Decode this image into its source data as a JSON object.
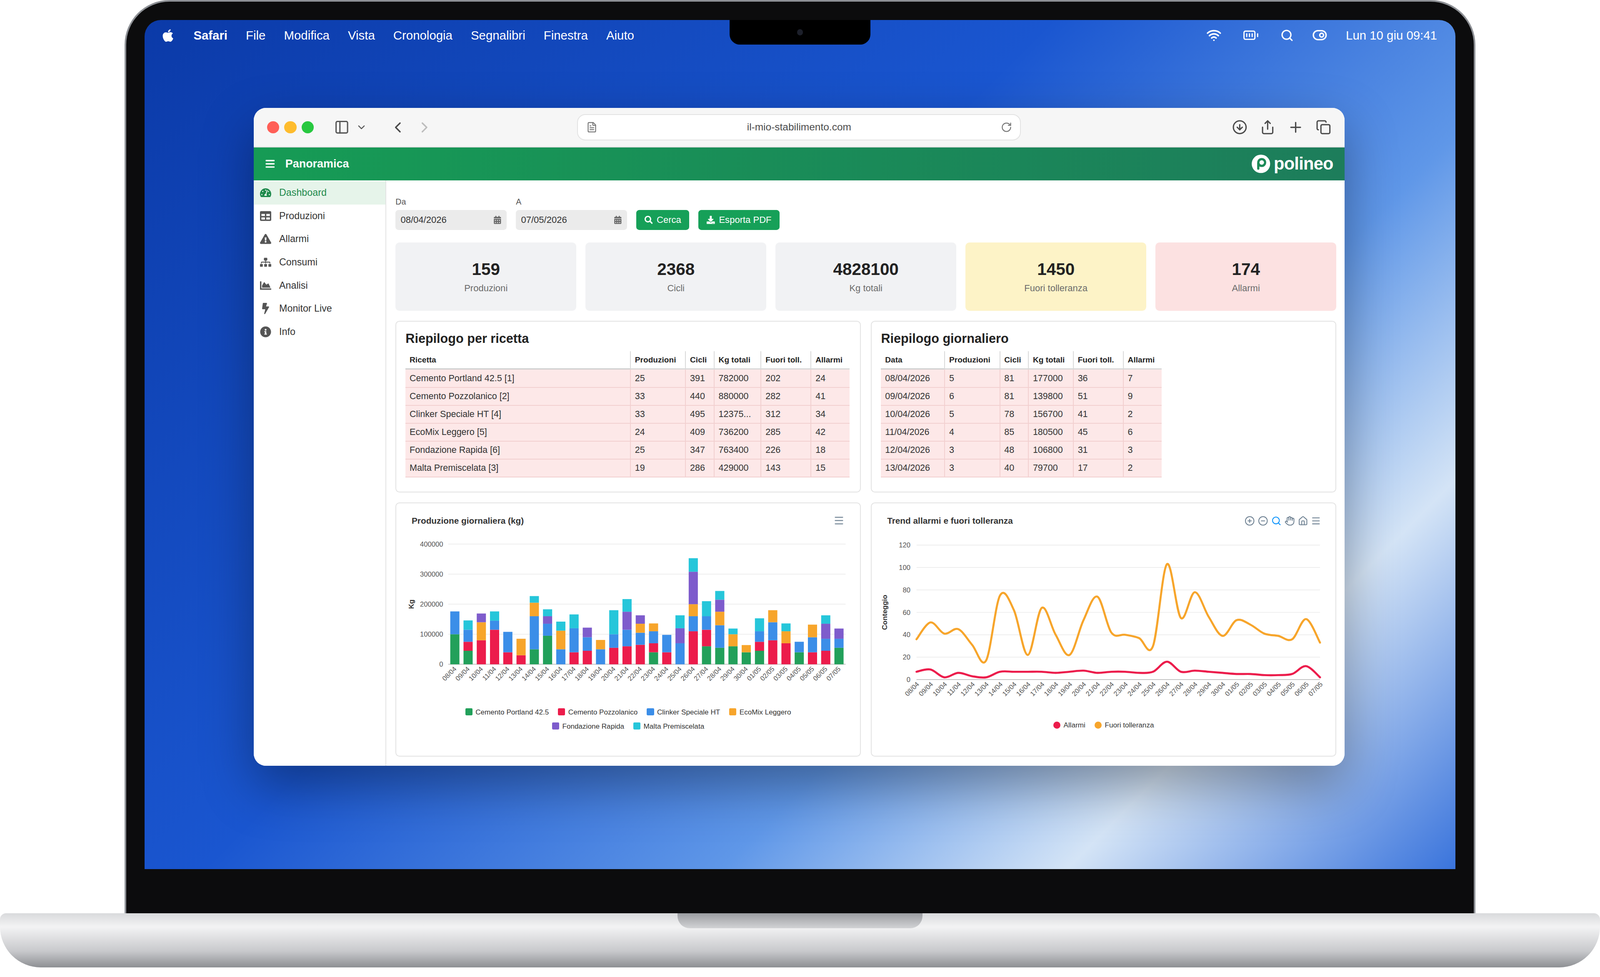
{
  "menu_bar": {
    "app": "Safari",
    "items": [
      "File",
      "Modifica",
      "Vista",
      "Cronologia",
      "Segnalibri",
      "Finestra",
      "Aiuto"
    ],
    "clock": "Lun 10 giu 09:41"
  },
  "browser": {
    "url": "il-mio-stabilimento.com",
    "back_enabled": true,
    "forward_enabled": false
  },
  "app_header": {
    "title": "Panoramica",
    "logo": "polineo"
  },
  "sidebar": {
    "items": [
      {
        "label": "Dashboard",
        "selected": true
      },
      {
        "label": "Produzioni",
        "selected": false
      },
      {
        "label": "Allarmi",
        "selected": false
      },
      {
        "label": "Consumi",
        "selected": false
      },
      {
        "label": "Analisi",
        "selected": false
      },
      {
        "label": "Monitor Live",
        "selected": false
      },
      {
        "label": "Info",
        "selected": false
      }
    ]
  },
  "filters": {
    "from": {
      "label": "Da",
      "value": "08/04/2026"
    },
    "to": {
      "label": "A",
      "value": "07/05/2026"
    },
    "buttons": [
      "Cerca",
      "Esporta PDF"
    ]
  },
  "kpis": [
    {
      "value": "159",
      "label": "Produzioni",
      "color": "#f1f2f4"
    },
    {
      "value": "2368",
      "label": "Cicli",
      "color": "#f1f2f4"
    },
    {
      "value": "4828100",
      "label": "Kg totali",
      "color": "#f1f2f4"
    },
    {
      "value": "1450",
      "label": "Fuori tolleranza",
      "color": "#fdf3c7"
    },
    {
      "value": "174",
      "label": "Allarmi",
      "color": "#fce1e1"
    }
  ],
  "recipe_table": {
    "title": "Riepilogo per ricetta",
    "columns": [
      "Ricetta",
      "Produzioni",
      "Cicli",
      "Kg totali",
      "Fuori toll.",
      "Allarmi"
    ],
    "rows": [
      [
        "Cemento Portland 42.5 [1]",
        "25",
        "391",
        "782000",
        "202",
        "24"
      ],
      [
        "Cemento Pozzolanico [2]",
        "33",
        "440",
        "880000",
        "282",
        "41"
      ],
      [
        "Clinker Speciale HT [4]",
        "33",
        "495",
        "12375...",
        "312",
        "34"
      ],
      [
        "EcoMix Leggero [5]",
        "24",
        "409",
        "736200",
        "285",
        "42"
      ],
      [
        "Fondazione Rapida [6]",
        "25",
        "347",
        "763400",
        "226",
        "18"
      ],
      [
        "Malta Premiscelata [3]",
        "19",
        "286",
        "429000",
        "143",
        "15"
      ]
    ]
  },
  "daily_table": {
    "title": "Riepilogo giornaliero",
    "columns": [
      "Data",
      "Produzioni",
      "Cicli",
      "Kg totali",
      "Fuori toll.",
      "Allarmi"
    ],
    "rows": [
      [
        "08/04/2026",
        "5",
        "81",
        "177000",
        "36",
        "7"
      ],
      [
        "09/04/2026",
        "6",
        "81",
        "139800",
        "51",
        "9"
      ],
      [
        "10/04/2026",
        "5",
        "78",
        "156700",
        "41",
        "2"
      ],
      [
        "11/04/2026",
        "4",
        "85",
        "180500",
        "45",
        "6"
      ],
      [
        "12/04/2026",
        "3",
        "48",
        "106800",
        "31",
        "3"
      ],
      [
        "13/04/2026",
        "3",
        "40",
        "79700",
        "17",
        "2"
      ]
    ]
  },
  "production_chart": {
    "title": "Produzione giornaliera (kg)",
    "y_axis_label": "Kg",
    "y_ticks": [
      "400000",
      "300000",
      "200000",
      "100000",
      "0"
    ],
    "x_labels": [
      "08/04",
      "09/04",
      "10/04",
      "11/04",
      "12/04",
      "13/04",
      "14/04",
      "15/04",
      "16/04",
      "17/04",
      "18/04",
      "19/04",
      "20/04",
      "21/04",
      "22/04",
      "23/04",
      "24/04",
      "25/04",
      "26/04",
      "27/04",
      "28/04",
      "29/04",
      "30/04",
      "01/05",
      "02/05",
      "03/05",
      "04/05",
      "05/05",
      "06/05",
      "07/05"
    ],
    "series": [
      {
        "name": "Cemento Portland 42.5",
        "color": "#22a05a",
        "values": [
          100000,
          45000,
          0,
          0,
          0,
          0,
          50000,
          95000,
          0,
          0,
          0,
          0,
          0,
          0,
          0,
          40000,
          0,
          0,
          0,
          60000,
          55000,
          60000,
          40000,
          45000,
          0,
          0,
          40000,
          0,
          0,
          55000
        ]
      },
      {
        "name": "Cemento Pozzolanico",
        "color": "#ec1c4b",
        "values": [
          0,
          30000,
          80000,
          115000,
          40000,
          30000,
          0,
          0,
          0,
          40000,
          45000,
          0,
          55000,
          60000,
          65000,
          30000,
          40000,
          0,
          110000,
          55000,
          0,
          0,
          0,
          30000,
          80000,
          70000,
          0,
          40000,
          45000,
          0
        ]
      },
      {
        "name": "Clinker Speciale HT",
        "color": "#3b8ee8",
        "values": [
          76000,
          40000,
          0,
          30000,
          68000,
          0,
          110000,
          40000,
          50000,
          80000,
          45000,
          50000,
          45000,
          55000,
          40000,
          40000,
          58000,
          70000,
          50000,
          45000,
          75000,
          0,
          0,
          35000,
          60000,
          0,
          35000,
          50000,
          40000,
          30000
        ]
      },
      {
        "name": "EcoMix Leggero",
        "color": "#f7a52b",
        "values": [
          0,
          0,
          60000,
          0,
          0,
          55000,
          45000,
          0,
          62000,
          0,
          0,
          31000,
          0,
          0,
          30000,
          26000,
          0,
          0,
          40000,
          0,
          45000,
          40000,
          24000,
          0,
          40000,
          40000,
          0,
          42000,
          0,
          0
        ]
      },
      {
        "name": "Fondazione Rapida",
        "color": "#7e5ccc",
        "values": [
          0,
          0,
          29000,
          0,
          0,
          0,
          0,
          25000,
          0,
          0,
          32000,
          0,
          0,
          60000,
          28000,
          0,
          0,
          50000,
          108000,
          0,
          40000,
          0,
          0,
          0,
          0,
          0,
          0,
          0,
          50000,
          34000
        ]
      },
      {
        "name": "Malta Premiscelata",
        "color": "#26c6da",
        "values": [
          0,
          31000,
          0,
          31000,
          0,
          0,
          22000,
          23000,
          30000,
          46000,
          0,
          0,
          80000,
          42000,
          0,
          0,
          0,
          43000,
          45000,
          50000,
          29000,
          19000,
          0,
          43000,
          0,
          26000,
          0,
          0,
          28000,
          0
        ]
      }
    ]
  },
  "trend_chart": {
    "title": "Trend allarmi e fuori tolleranza",
    "toolbar": [
      {
        "selected": false
      },
      {
        "selected": false
      },
      {
        "selected": true
      },
      {
        "selected": false
      },
      {
        "selected": false
      },
      {
        "selected": false
      }
    ],
    "y_axis_label": "Conteggio",
    "y_ticks": [
      "120",
      "100",
      "80",
      "60",
      "40",
      "20",
      "0"
    ],
    "x_labels": [
      "08/04",
      "09/04",
      "10/04",
      "11/04",
      "12/04",
      "13/04",
      "14/04",
      "15/04",
      "16/04",
      "17/04",
      "18/04",
      "19/04",
      "20/04",
      "21/04",
      "22/04",
      "23/04",
      "24/04",
      "25/04",
      "26/04",
      "27/04",
      "28/04",
      "29/04",
      "30/04",
      "01/05",
      "02/05",
      "03/05",
      "04/05",
      "05/05",
      "06/05",
      "07/05"
    ],
    "series": [
      {
        "name": "Allarmi",
        "color": "#ec1c4b",
        "values": [
          7,
          9,
          2,
          6,
          3,
          2,
          7,
          7,
          7,
          7,
          6,
          7,
          8,
          6,
          7,
          7,
          6,
          7,
          16,
          7,
          8,
          7,
          6,
          5,
          5,
          4,
          4,
          5,
          12,
          2
        ]
      },
      {
        "name": "Fuori tolleranza",
        "color": "#f7a52b",
        "values": [
          36,
          51,
          41,
          45,
          31,
          17,
          75,
          62,
          22,
          64,
          40,
          22,
          53,
          74,
          42,
          40,
          37,
          30,
          103,
          55,
          78,
          56,
          39,
          53,
          49,
          41,
          39,
          36,
          54,
          33
        ]
      }
    ]
  }
}
